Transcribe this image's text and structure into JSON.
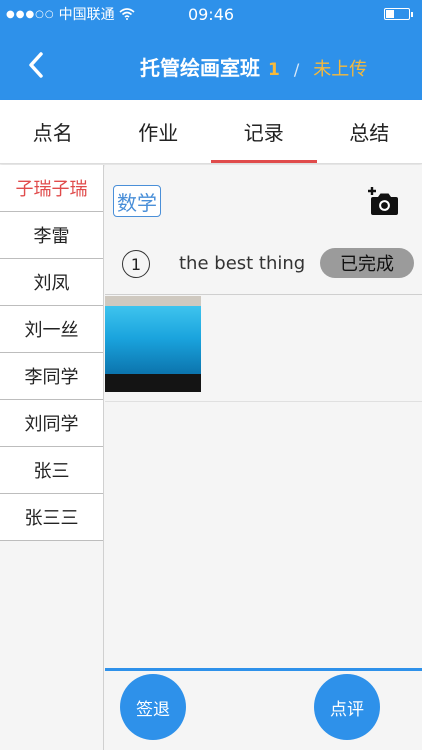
{
  "status_bar": {
    "carrier": "中国联通",
    "time": "09:46"
  },
  "nav": {
    "title": "托管绘画室班",
    "count": "1",
    "separator": "/",
    "upload_status": "未上传"
  },
  "tabs": [
    {
      "label": "点名"
    },
    {
      "label": "作业"
    },
    {
      "label": "记录"
    },
    {
      "label": "总结"
    }
  ],
  "active_tab": "记录",
  "students": [
    {
      "name": "子瑞子瑞"
    },
    {
      "name": "李雷"
    },
    {
      "name": "刘凤"
    },
    {
      "name": "刘一丝"
    },
    {
      "name": "李同学"
    },
    {
      "name": "刘同学"
    },
    {
      "name": "张三"
    },
    {
      "name": "张三三"
    }
  ],
  "selected_student": "子瑞子瑞",
  "record": {
    "subject": "数学",
    "task_number": "①",
    "task_text": "the best thing",
    "task_status": "已完成"
  },
  "buttons": {
    "sign_out": "签退",
    "comment": "点评"
  },
  "colors": {
    "brand_blue": "#2e91ea",
    "active_red": "#e04b4b",
    "accent_orange": "#f6b93b"
  }
}
